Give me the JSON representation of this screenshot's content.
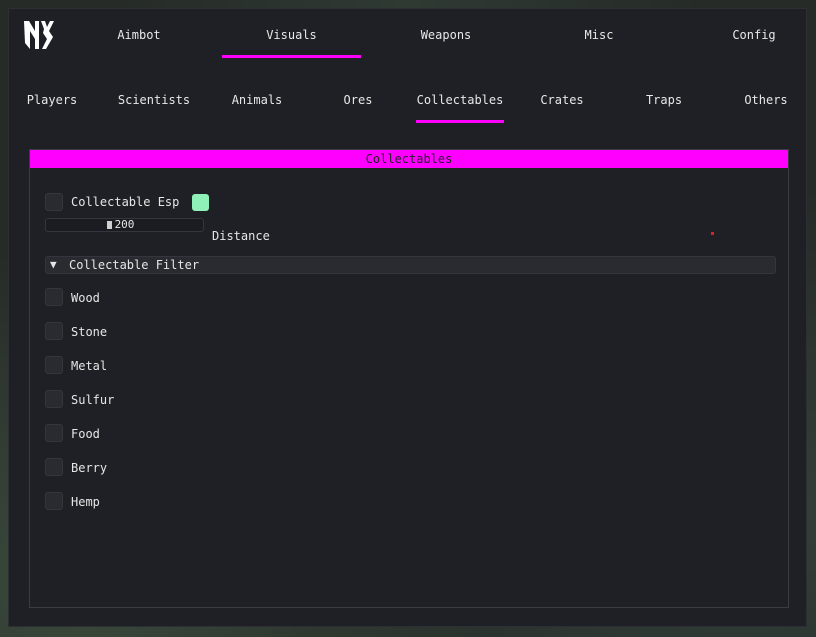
{
  "colors": {
    "accent": "#ff00ff",
    "esp_color": "#8ff0b8"
  },
  "logo_icon": "ny-logo",
  "top_tabs": [
    {
      "label": "Aimbot",
      "active": false
    },
    {
      "label": "Visuals",
      "active": true
    },
    {
      "label": "Weapons",
      "active": false
    },
    {
      "label": "Misc",
      "active": false
    },
    {
      "label": "Config",
      "active": false
    }
  ],
  "sub_tabs": [
    {
      "label": "Players",
      "active": false
    },
    {
      "label": "Scientists",
      "active": false
    },
    {
      "label": "Animals",
      "active": false
    },
    {
      "label": "Ores",
      "active": false
    },
    {
      "label": "Collectables",
      "active": true
    },
    {
      "label": "Crates",
      "active": false
    },
    {
      "label": "Traps",
      "active": false
    },
    {
      "label": "Others",
      "active": false
    }
  ],
  "panel": {
    "title": "Collectables",
    "esp_label": "Collectable Esp",
    "esp_checked": false,
    "distance": {
      "value": "200",
      "label": "Distance",
      "fraction": 0.4
    },
    "filter": {
      "title": "Collectable Filter",
      "expanded": true,
      "arrow_icon": "triangle-down-icon",
      "items": [
        {
          "label": "Wood",
          "checked": false
        },
        {
          "label": "Stone",
          "checked": false
        },
        {
          "label": "Metal",
          "checked": false
        },
        {
          "label": "Sulfur",
          "checked": false
        },
        {
          "label": "Food",
          "checked": false
        },
        {
          "label": "Berry",
          "checked": false
        },
        {
          "label": "Hemp",
          "checked": false
        }
      ]
    }
  }
}
